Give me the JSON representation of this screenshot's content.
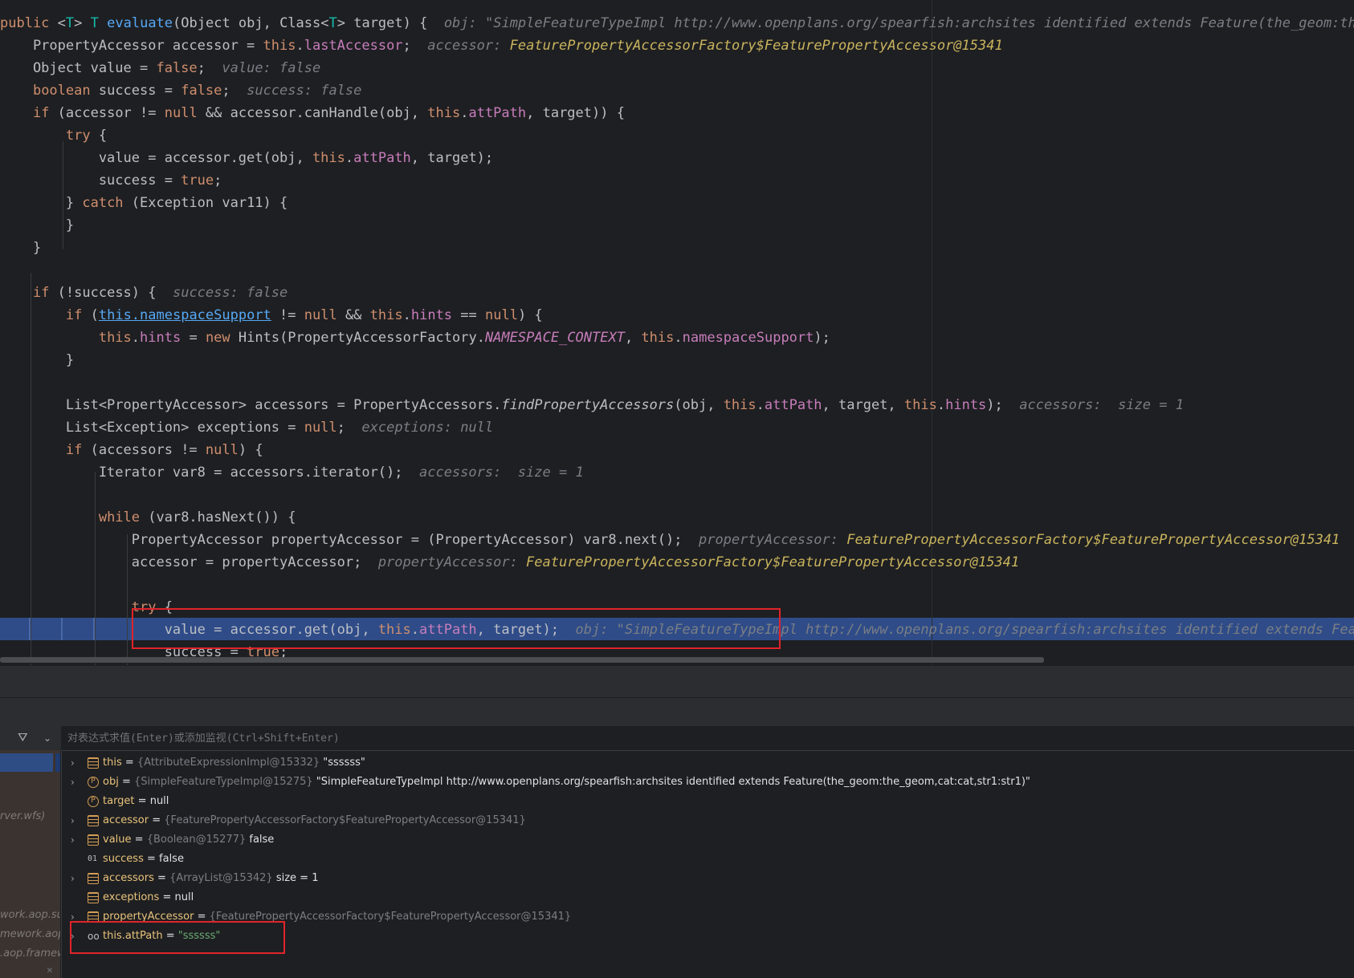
{
  "editor": {
    "lines": [
      [
        {
          "t": "public ",
          "c": "kw"
        },
        {
          "t": "<"
        },
        {
          "t": "T",
          "c": "tp"
        },
        {
          "t": "> "
        },
        {
          "t": "T",
          "c": "tp"
        },
        {
          "t": " "
        },
        {
          "t": "evaluate",
          "c": "fn"
        },
        {
          "t": "(Object obj, Class<"
        },
        {
          "t": "T",
          "c": "tp"
        },
        {
          "t": "> target) {  "
        },
        {
          "t": "obj: \"SimpleFeatureTypeImpl http://www.openplans.org/spearfish:archsites identified extends Feature(the_geom:the_g",
          "c": "hint"
        }
      ],
      [
        {
          "t": "    PropertyAccessor accessor = "
        },
        {
          "t": "this",
          "c": "kw"
        },
        {
          "t": "."
        },
        {
          "t": "lastAccessor",
          "c": "fld"
        },
        {
          "t": ";  "
        },
        {
          "t": "accessor: ",
          "c": "hint"
        },
        {
          "t": "FeaturePropertyAccessorFactory$FeaturePropertyAccessor@15341",
          "c": "hv"
        }
      ],
      [
        {
          "t": "    Object value = "
        },
        {
          "t": "false",
          "c": "kw"
        },
        {
          "t": ";  "
        },
        {
          "t": "value: false",
          "c": "hint"
        }
      ],
      [
        {
          "t": "    "
        },
        {
          "t": "boolean",
          "c": "kw"
        },
        {
          "t": " success = "
        },
        {
          "t": "false",
          "c": "kw"
        },
        {
          "t": ";  "
        },
        {
          "t": "success: false",
          "c": "hint"
        }
      ],
      [
        {
          "t": "    "
        },
        {
          "t": "if",
          "c": "kw"
        },
        {
          "t": " (accessor != "
        },
        {
          "t": "null",
          "c": "kw"
        },
        {
          "t": " && accessor.canHandle(obj, "
        },
        {
          "t": "this",
          "c": "kw"
        },
        {
          "t": "."
        },
        {
          "t": "attPath",
          "c": "fld"
        },
        {
          "t": ", target)) {"
        }
      ],
      [
        {
          "t": "        "
        },
        {
          "t": "try",
          "c": "kw"
        },
        {
          "t": " {"
        }
      ],
      [
        {
          "t": "            value = accessor.get(obj, "
        },
        {
          "t": "this",
          "c": "kw"
        },
        {
          "t": "."
        },
        {
          "t": "attPath",
          "c": "fld"
        },
        {
          "t": ", target);"
        }
      ],
      [
        {
          "t": "            success = "
        },
        {
          "t": "true",
          "c": "kw"
        },
        {
          "t": ";"
        }
      ],
      [
        {
          "t": "        } "
        },
        {
          "t": "catch",
          "c": "kw"
        },
        {
          "t": " (Exception var11) {"
        }
      ],
      [
        {
          "t": "        }"
        }
      ],
      [
        {
          "t": "    }"
        }
      ],
      [],
      [
        {
          "t": "    "
        },
        {
          "t": "if",
          "c": "kw"
        },
        {
          "t": " (!success) {  "
        },
        {
          "t": "success: false",
          "c": "hint"
        }
      ],
      [
        {
          "t": "        "
        },
        {
          "t": "if",
          "c": "kw"
        },
        {
          "t": " ("
        },
        {
          "t": "this.namespaceSupport",
          "c": "lnk"
        },
        {
          "t": " != "
        },
        {
          "t": "null",
          "c": "kw"
        },
        {
          "t": " && "
        },
        {
          "t": "this",
          "c": "kw"
        },
        {
          "t": "."
        },
        {
          "t": "hints",
          "c": "fld"
        },
        {
          "t": " == "
        },
        {
          "t": "null",
          "c": "kw"
        },
        {
          "t": ") {"
        }
      ],
      [
        {
          "t": "            "
        },
        {
          "t": "this",
          "c": "kw"
        },
        {
          "t": "."
        },
        {
          "t": "hints",
          "c": "fld"
        },
        {
          "t": " = "
        },
        {
          "t": "new",
          "c": "kw"
        },
        {
          "t": " Hints(PropertyAccessorFactory."
        },
        {
          "t": "NAMESPACE_CONTEXT",
          "c": "st"
        },
        {
          "t": ", "
        },
        {
          "t": "this",
          "c": "kw"
        },
        {
          "t": "."
        },
        {
          "t": "namespaceSupport",
          "c": "fld"
        },
        {
          "t": ");"
        }
      ],
      [
        {
          "t": "        }"
        }
      ],
      [],
      [
        {
          "t": "        List<PropertyAccessor> accessors = PropertyAccessors."
        },
        {
          "t": "findPropertyAccessors",
          "c": "sm"
        },
        {
          "t": "(obj, "
        },
        {
          "t": "this",
          "c": "kw"
        },
        {
          "t": "."
        },
        {
          "t": "attPath",
          "c": "fld"
        },
        {
          "t": ", target, "
        },
        {
          "t": "this",
          "c": "kw"
        },
        {
          "t": "."
        },
        {
          "t": "hints",
          "c": "fld"
        },
        {
          "t": ");  "
        },
        {
          "t": "accessors:  size = 1",
          "c": "hint"
        }
      ],
      [
        {
          "t": "        List<Exception> exceptions = "
        },
        {
          "t": "null",
          "c": "kw"
        },
        {
          "t": ";  "
        },
        {
          "t": "exceptions: null",
          "c": "hint"
        }
      ],
      [
        {
          "t": "        "
        },
        {
          "t": "if",
          "c": "kw"
        },
        {
          "t": " (accessors != "
        },
        {
          "t": "null",
          "c": "kw"
        },
        {
          "t": ") {"
        }
      ],
      [
        {
          "t": "            Iterator var8 = accessors.iterator();  "
        },
        {
          "t": "accessors:  size = 1",
          "c": "hint"
        }
      ],
      [],
      [
        {
          "t": "            "
        },
        {
          "t": "while",
          "c": "kw"
        },
        {
          "t": " (var8.hasNext()) {"
        }
      ],
      [
        {
          "t": "                PropertyAccessor propertyAccessor = (PropertyAccessor) var8.next();  "
        },
        {
          "t": "propertyAccessor: ",
          "c": "hint"
        },
        {
          "t": "FeaturePropertyAccessorFactory$FeaturePropertyAccessor@15341",
          "c": "hv"
        }
      ],
      [
        {
          "t": "                accessor = propertyAccessor;  "
        },
        {
          "t": "propertyAccessor: ",
          "c": "hint"
        },
        {
          "t": "FeaturePropertyAccessorFactory$FeaturePropertyAccessor@15341",
          "c": "hv"
        }
      ],
      [],
      [
        {
          "t": "                "
        },
        {
          "t": "try",
          "c": "kw"
        },
        {
          "t": " {"
        }
      ],
      [
        {
          "t": "                    value = accessor.get(obj, "
        },
        {
          "t": "this",
          "c": "kw"
        },
        {
          "t": "."
        },
        {
          "t": "attPath",
          "c": "fld"
        },
        {
          "t": ", target);  "
        },
        {
          "t": "obj: \"SimpleFeatureTypeImpl http://www.openplans.org/spearfish:archsites identified extends Featur",
          "c": "hint"
        }
      ],
      [
        {
          "t": "                    success = "
        },
        {
          "t": "true",
          "c": "kw"
        },
        {
          "t": ";"
        }
      ]
    ]
  },
  "debugger": {
    "eval_placeholder": "对表达式求值(Enter)或添加监视(Ctrl+Shift+Enter)",
    "frames": [
      "rver.wfs)",
      "work.aop.sup",
      "mework.aop",
      ".aop.framew"
    ],
    "variables": [
      {
        "expand": true,
        "icon": "field-icon",
        "name": "this",
        "type": "{AttributeExpressionImpl@15332}",
        "value": "\"ssssss\"",
        "vclass": "vval"
      },
      {
        "expand": true,
        "icon": "param-icon",
        "name": "obj",
        "type": "{SimpleFeatureTypeImpl@15275}",
        "value": "\"SimpleFeatureTypeImpl http://www.openplans.org/spearfish:archsites identified extends Feature(the_geom:the_geom,cat:cat,str1:str1)\"",
        "vclass": "vval"
      },
      {
        "expand": false,
        "icon": "param-icon",
        "name": "target",
        "type": "",
        "value": "null",
        "vclass": "vval"
      },
      {
        "expand": true,
        "icon": "field-icon",
        "name": "accessor",
        "type": "{FeaturePropertyAccessorFactory$FeaturePropertyAccessor@15341}",
        "value": "",
        "vclass": "vval"
      },
      {
        "expand": true,
        "icon": "field-icon",
        "name": "value",
        "type": "{Boolean@15277}",
        "value": "false",
        "vclass": "vval"
      },
      {
        "expand": false,
        "icon": "bool-icon",
        "name": "success",
        "type": "",
        "value": "false",
        "vclass": "vval"
      },
      {
        "expand": true,
        "icon": "field-icon",
        "name": "accessors",
        "type": "{ArrayList@15342}",
        "value": " size = 1",
        "vclass": "vval"
      },
      {
        "expand": false,
        "icon": "field-icon",
        "name": "exceptions",
        "type": "",
        "value": "null",
        "vclass": "vval"
      },
      {
        "expand": true,
        "icon": "field-icon",
        "name": "propertyAccessor",
        "type": "{FeaturePropertyAccessorFactory$FeaturePropertyAccessor@15341}",
        "value": "",
        "vclass": "vval"
      },
      {
        "expand": true,
        "icon": "watch-icon",
        "name": "this.attPath",
        "type": "",
        "value": "\"ssssss\"",
        "vclass": "vstr"
      }
    ]
  }
}
